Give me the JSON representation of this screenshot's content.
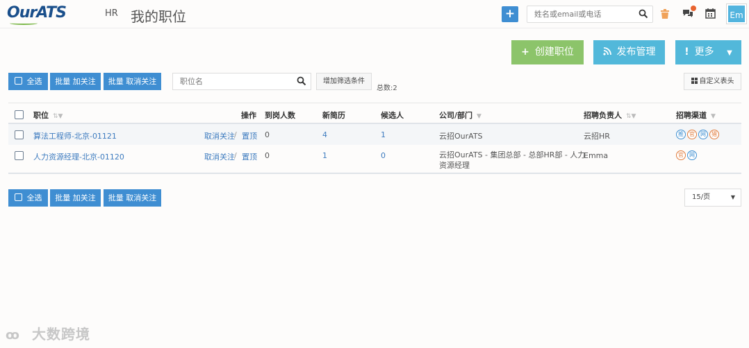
{
  "header": {
    "logo": "OurATS",
    "hr_label": "HR",
    "title": "我的职位",
    "search_placeholder": "姓名或email或电话",
    "avatar": "Em"
  },
  "actions": {
    "create": "创建职位",
    "publish": "发布管理",
    "more": "更多"
  },
  "toolbar": {
    "select_all": "全选",
    "batch_follow": "批量 加关注",
    "batch_unfollow": "批量 取消关注",
    "position_placeholder": "职位名",
    "add_filter": "增加筛选条件",
    "total": "总数:2",
    "custom_columns": "自定义表头"
  },
  "table": {
    "headers": {
      "position": "职位",
      "operation": "操作",
      "arrived": "到岗人数",
      "new_resumes": "新简历",
      "candidates": "候选人",
      "company": "公司/部门",
      "recruiter": "招聘负责人",
      "channel": "招聘渠道"
    },
    "rows": [
      {
        "position": "算法工程师-北京-01121",
        "unfollow": "取消关注",
        "sep": "/",
        "pin": "置顶",
        "arrived": "0",
        "new_resumes": "4",
        "candidates": "1",
        "company_line1": "云招OurATS",
        "company_line2": "",
        "recruiter": "云招HR",
        "channels": [
          "推",
          "官",
          "网",
          "猎"
        ]
      },
      {
        "position": "人力资源经理-北京-01120",
        "unfollow": "取消关注",
        "sep": "/",
        "pin": "置顶",
        "arrived": "0",
        "new_resumes": "1",
        "candidates": "0",
        "company_line1": "云招OurATS - 集团总部 - 总部HR部 - 人力",
        "company_line2": "资源经理",
        "recruiter": "Emma",
        "channels": [
          "官",
          "网"
        ]
      }
    ]
  },
  "footer": {
    "select_all": "全选",
    "batch_follow": "批量 加关注",
    "batch_unfollow": "批量 取消关注",
    "page_size": "15/页"
  },
  "watermark": "大数跨境",
  "colors": {
    "primary": "#3f8ed2",
    "green": "#8cc46a",
    "cyan": "#52b8da",
    "link": "#3d7bbf"
  }
}
